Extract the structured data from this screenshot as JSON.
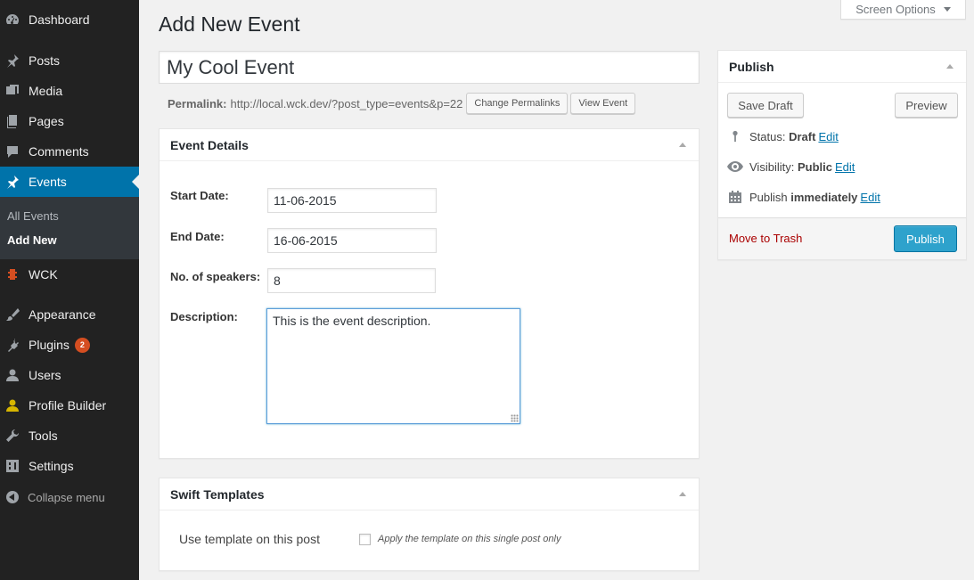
{
  "sidebar": {
    "items": [
      {
        "label": "Dashboard",
        "icon": "dashboard-icon"
      },
      {
        "label": "Posts",
        "icon": "pin-icon"
      },
      {
        "label": "Media",
        "icon": "media-icon"
      },
      {
        "label": "Pages",
        "icon": "pages-icon"
      },
      {
        "label": "Comments",
        "icon": "comments-icon"
      },
      {
        "label": "Events",
        "icon": "pin-icon"
      },
      {
        "label": "WCK",
        "icon": "wck-icon"
      },
      {
        "label": "Appearance",
        "icon": "brush-icon"
      },
      {
        "label": "Plugins",
        "icon": "plugin-icon",
        "badge": "2"
      },
      {
        "label": "Users",
        "icon": "users-icon"
      },
      {
        "label": "Profile Builder",
        "icon": "profile-icon"
      },
      {
        "label": "Tools",
        "icon": "wrench-icon"
      },
      {
        "label": "Settings",
        "icon": "settings-icon"
      }
    ],
    "submenu": [
      {
        "label": "All Events"
      },
      {
        "label": "Add New"
      }
    ],
    "collapse_label": "Collapse menu"
  },
  "header": {
    "title": "Add New Event",
    "screen_options": "Screen Options"
  },
  "post": {
    "title_value": "My Cool Event",
    "permalink_label": "Permalink:",
    "permalink_url": "http://local.wck.dev/?post_type=events&p=22",
    "change_permalinks": "Change Permalinks",
    "view_event": "View Event"
  },
  "event_details": {
    "heading": "Event Details",
    "start_label": "Start Date:",
    "start_value": "11-06-2015",
    "end_label": "End Date:",
    "end_value": "16-06-2015",
    "speakers_label": "No. of speakers:",
    "speakers_value": "8",
    "description_label": "Description:",
    "description_value": "This is the event description."
  },
  "swift": {
    "heading": "Swift Templates",
    "use_label": "Use template on this post",
    "checkbox_label": "Apply the template on this single post only"
  },
  "publish": {
    "heading": "Publish",
    "save_draft": "Save Draft",
    "preview": "Preview",
    "status_label": "Status:",
    "status_value": "Draft",
    "visibility_label": "Visibility:",
    "visibility_value": "Public",
    "publish_label": "Publish",
    "publish_value": "immediately",
    "edit": "Edit",
    "move_to_trash": "Move to Trash",
    "publish_button": "Publish"
  },
  "colors": {
    "sidebar_bg": "#222222",
    "active_bg": "#0073aa",
    "publish_button": "#2ea2cc",
    "trash_link": "#aa0000",
    "badge": "#d54e21"
  }
}
